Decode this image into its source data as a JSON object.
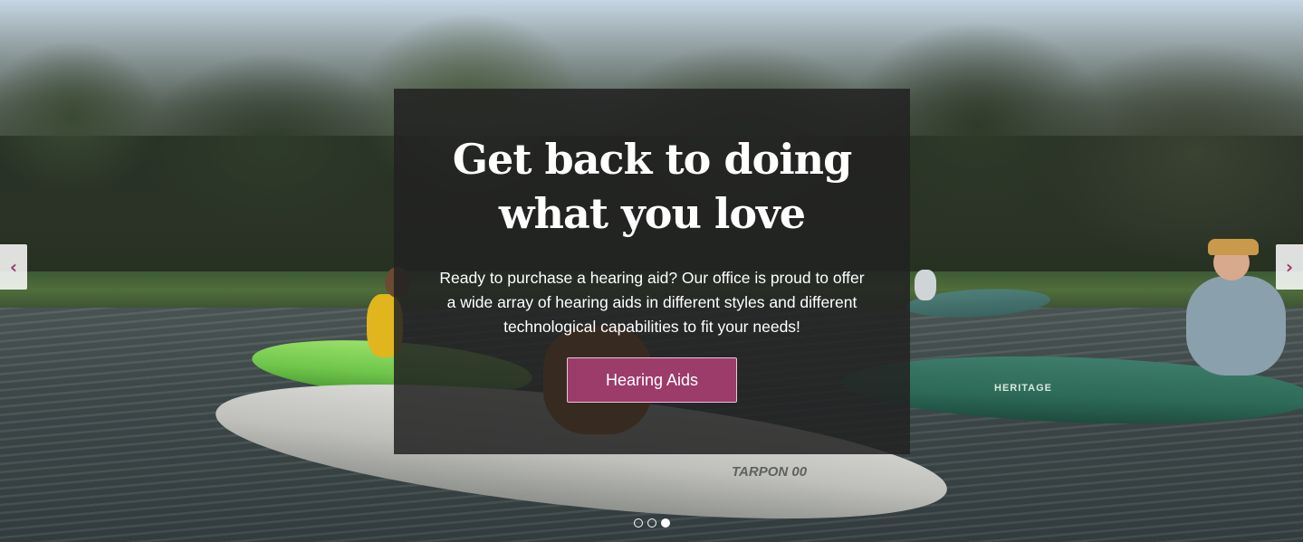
{
  "hero": {
    "headline": "Get back to doing what you love",
    "subtext": "Ready to purchase a hearing aid? Our office is proud to offer a wide array of hearing aids in different styles and different technological capabilities to fit your needs!",
    "cta_label": "Hearing Aids",
    "background_text": {
      "kayak_brand_1": "TARPON 00",
      "kayak_brand_2": "HERITAGE"
    }
  },
  "carousel": {
    "prev_arrow": "‹",
    "next_arrow": "›",
    "slide_count": 3,
    "active_slide": 3
  },
  "colors": {
    "accent": "#9b3c6b",
    "overlay": "#222222",
    "text": "#ffffff"
  },
  "icons": {
    "prev": "chevron-left-icon",
    "next": "chevron-right-icon"
  }
}
